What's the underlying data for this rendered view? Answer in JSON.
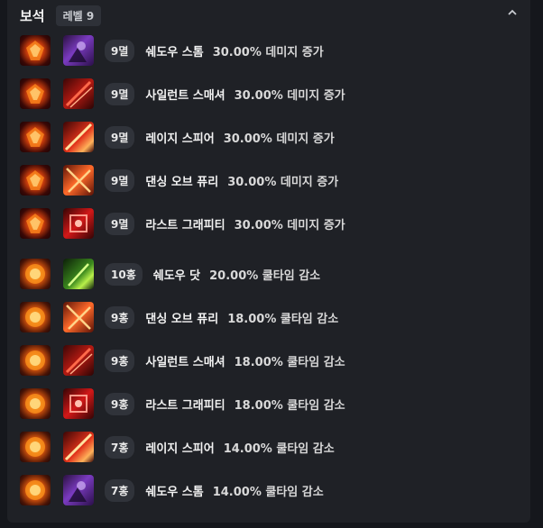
{
  "section": {
    "title": "보석",
    "level_label": "레벨 9"
  },
  "icons": {
    "collapse": "chevron-up-icon"
  },
  "gems": [
    {
      "gem_type": "damage",
      "skill_icon": "shadow-storm",
      "level": "9멸",
      "skill": "쉐도우 스톰",
      "effect": "30.00% 데미지 증가"
    },
    {
      "gem_type": "damage",
      "skill_icon": "violent-scythe",
      "level": "9멸",
      "skill": "사일런트 스매셔",
      "effect": "30.00% 데미지 증가"
    },
    {
      "gem_type": "damage",
      "skill_icon": "rage-spear",
      "level": "9멸",
      "skill": "레이지 스피어",
      "effect": "30.00% 데미지 증가"
    },
    {
      "gem_type": "damage",
      "skill_icon": "dancing-fury",
      "level": "9멸",
      "skill": "댄싱 오브 퓨리",
      "effect": "30.00% 데미지 증가"
    },
    {
      "gem_type": "damage",
      "skill_icon": "last-graffiti",
      "level": "9멸",
      "skill": "라스트 그래피티",
      "effect": "30.00% 데미지 증가"
    },
    {
      "gem_type": "cooldown",
      "skill_icon": "shadow-dot",
      "level": "10홍",
      "skill": "쉐도우 닷",
      "effect": "20.00% 쿨타임 감소"
    },
    {
      "gem_type": "cooldown",
      "skill_icon": "dancing-fury",
      "level": "9홍",
      "skill": "댄싱 오브 퓨리",
      "effect": "18.00% 쿨타임 감소"
    },
    {
      "gem_type": "cooldown",
      "skill_icon": "violent-scythe",
      "level": "9홍",
      "skill": "사일런트 스매셔",
      "effect": "18.00% 쿨타임 감소"
    },
    {
      "gem_type": "cooldown",
      "skill_icon": "last-graffiti",
      "level": "9홍",
      "skill": "라스트 그래피티",
      "effect": "18.00% 쿨타임 감소"
    },
    {
      "gem_type": "cooldown",
      "skill_icon": "rage-spear",
      "level": "7홍",
      "skill": "레이지 스피어",
      "effect": "14.00% 쿨타임 감소"
    },
    {
      "gem_type": "cooldown",
      "skill_icon": "shadow-storm",
      "level": "7홍",
      "skill": "쉐도우 스톰",
      "effect": "14.00% 쿨타임 감소"
    }
  ]
}
